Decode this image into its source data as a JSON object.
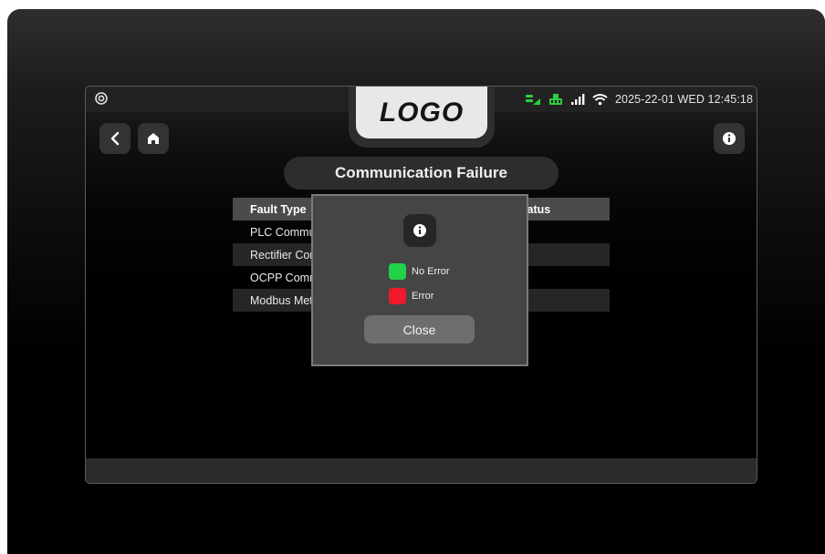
{
  "status_bar": {
    "datetime": "2025-22-01 WED 12:45:18",
    "icons": [
      "settings-icon",
      "charger-plug-icon",
      "network-lan-icon",
      "signal-bars-icon",
      "wifi-icon"
    ],
    "colors": {
      "green": "#2ecc40",
      "white": "#ffffff"
    }
  },
  "logo": {
    "text": "LOGO"
  },
  "nav": {
    "back_icon": "chevron-left-icon",
    "home_icon": "home-icon",
    "info_icon": "info-icon"
  },
  "page": {
    "title": "Communication Failure"
  },
  "table": {
    "headers": [
      "Fault Type",
      "Status"
    ],
    "rows": [
      {
        "fault": "PLC Communication",
        "status": ""
      },
      {
        "fault": "Rectifier Communication",
        "status": ""
      },
      {
        "fault": "OCPP Communication",
        "status": ""
      },
      {
        "fault": "Modbus Meter",
        "status": ""
      }
    ]
  },
  "modal": {
    "icon": "info-icon",
    "legend": [
      {
        "label": "No Error",
        "color": "#22d14a"
      },
      {
        "label": "Error",
        "color": "#f0192b"
      }
    ],
    "close_label": "Close"
  }
}
